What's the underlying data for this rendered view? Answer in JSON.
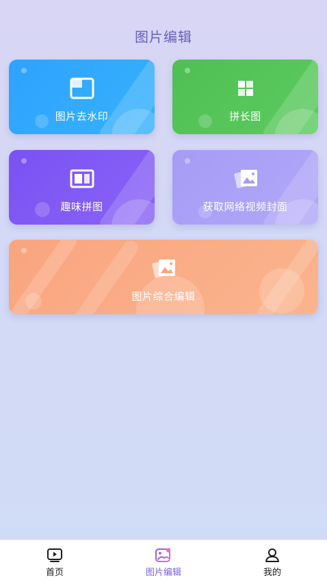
{
  "header": {
    "title": "图片编辑"
  },
  "cards": {
    "watermark": {
      "label": "图片去水印",
      "icon": "crop-frame-icon"
    },
    "long": {
      "label": "拼长图",
      "icon": "grid-tiles-icon"
    },
    "fun": {
      "label": "趣味拼图",
      "icon": "collage-layout-icon"
    },
    "cover": {
      "label": "获取网络视频封面",
      "icon": "photo-stack-icon"
    },
    "combo": {
      "label": "图片综合编辑",
      "icon": "photo-stack-icon"
    }
  },
  "tabbar": {
    "items": [
      {
        "label": "首页",
        "icon": "video-play-icon",
        "active": false
      },
      {
        "label": "图片编辑",
        "icon": "image-edit-icon",
        "active": true
      },
      {
        "label": "我的",
        "icon": "user-icon",
        "active": false
      }
    ],
    "active_color": "#7b5ef0"
  },
  "colors": {
    "watermark": "#2ea2ff",
    "long": "#4fbf55",
    "fun": "#7a52f3",
    "cover": "#a69cf6",
    "combo": "#f9a57f",
    "title": "#6a60b8"
  }
}
